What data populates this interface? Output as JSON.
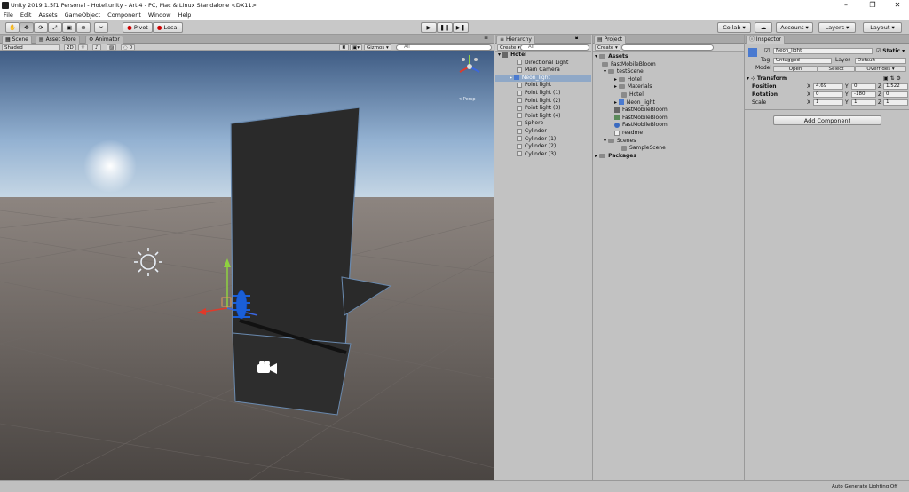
{
  "window": {
    "title": "Unity 2019.1.5f1 Personal - Hotel.unity - Arti4 - PC, Mac & Linux Standalone <DX11>",
    "min": "–",
    "max": "❐",
    "close": "✕"
  },
  "menu": [
    "File",
    "Edit",
    "Assets",
    "GameObject",
    "Component",
    "Window",
    "Help"
  ],
  "toolbar": {
    "tools": [
      "hand-tool",
      "move-tool",
      "rotate-tool",
      "scale-tool",
      "rect-tool",
      "transform-tool",
      "custom-tool"
    ],
    "pivot": "Pivot",
    "local": "Local",
    "collab": "Collab ▾",
    "account": "Account ▾",
    "layers": "Layers ▾",
    "layout": "Layout ▾"
  },
  "tabs": {
    "scene": "Scene",
    "asset_store": "Asset Store",
    "animator": "Animator",
    "hierarchy": "Hierarchy",
    "project": "Project",
    "inspector": "Inspector"
  },
  "scene_bar": {
    "shading": "Shaded",
    "mode2d": "2D",
    "gizmos": "Gizmos ▾",
    "search": "All",
    "fx_count": "0",
    "persp": "< Persp"
  },
  "hierarchy": {
    "create": "Create ▾",
    "search": "All",
    "root": "Hotel",
    "items": [
      "Directional Light",
      "Main Camera",
      "Neon_light",
      "Point light",
      "Point light (1)",
      "Point light (2)",
      "Point light (3)",
      "Point light (4)",
      "Sphere",
      "Cylinder",
      "Cylinder (1)",
      "Cylinder (2)",
      "Cylinder (3)"
    ],
    "selected": "Neon_light"
  },
  "project": {
    "create": "Create ▾",
    "rows": [
      {
        "label": "Assets",
        "bold": true
      },
      {
        "label": "FastMobileBloom"
      },
      {
        "label": "testScene"
      },
      {
        "label": "Hotel"
      },
      {
        "label": "Materials"
      },
      {
        "label": "Hotel"
      },
      {
        "label": "Neon_light"
      },
      {
        "label": "FastMobileBloom"
      },
      {
        "label": "FastMobileBloom"
      },
      {
        "label": "FastMobileBloom"
      },
      {
        "label": "readme"
      },
      {
        "label": "Scenes"
      },
      {
        "label": "SampleScene"
      },
      {
        "label": "Packages",
        "bold": true
      }
    ]
  },
  "inspector": {
    "name": "Neon_light",
    "static": "Static ▾",
    "tag_label": "Tag",
    "tag": "Untagged",
    "layer_label": "Layer",
    "layer": "Default",
    "model_label": "Model",
    "open": "Open",
    "select": "Select",
    "overrides": "Overrides ▾",
    "transform": "Transform",
    "position_label": "Position",
    "rotation_label": "Rotation",
    "scale_label": "Scale",
    "pos": {
      "x": "4.69",
      "y": "0",
      "z": "1.522"
    },
    "rot": {
      "x": "0",
      "y": "-180",
      "z": "0"
    },
    "scale": {
      "x": "1",
      "y": "1",
      "z": "1"
    },
    "axis_x": "X",
    "axis_y": "Y",
    "axis_z": "Z",
    "add_component": "Add Component"
  },
  "status": {
    "right": "Auto Generate Lighting Off"
  }
}
